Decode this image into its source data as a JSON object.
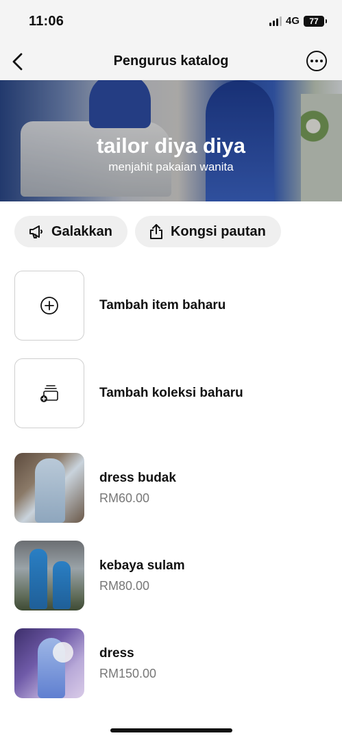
{
  "status_bar": {
    "time": "11:06",
    "network": "4G",
    "battery": "77"
  },
  "nav": {
    "title": "Pengurus katalog"
  },
  "cover": {
    "title": "tailor diya diya",
    "subtitle": "menjahit pakaian wanita"
  },
  "actions": {
    "promote_label": "Galakkan",
    "share_label": "Kongsi pautan"
  },
  "add_rows": {
    "add_item_label": "Tambah item baharu",
    "add_collection_label": "Tambah koleksi baharu"
  },
  "items": [
    {
      "title": "dress budak",
      "price": "RM60.00"
    },
    {
      "title": "kebaya sulam",
      "price": "RM80.00"
    },
    {
      "title": "dress",
      "price": "RM150.00"
    }
  ],
  "icons": {
    "back": "chevron-left-icon",
    "more": "more-horizontal-icon",
    "promote": "megaphone-icon",
    "share": "share-icon",
    "add_item": "plus-circle-icon",
    "add_collection": "collection-add-icon"
  }
}
